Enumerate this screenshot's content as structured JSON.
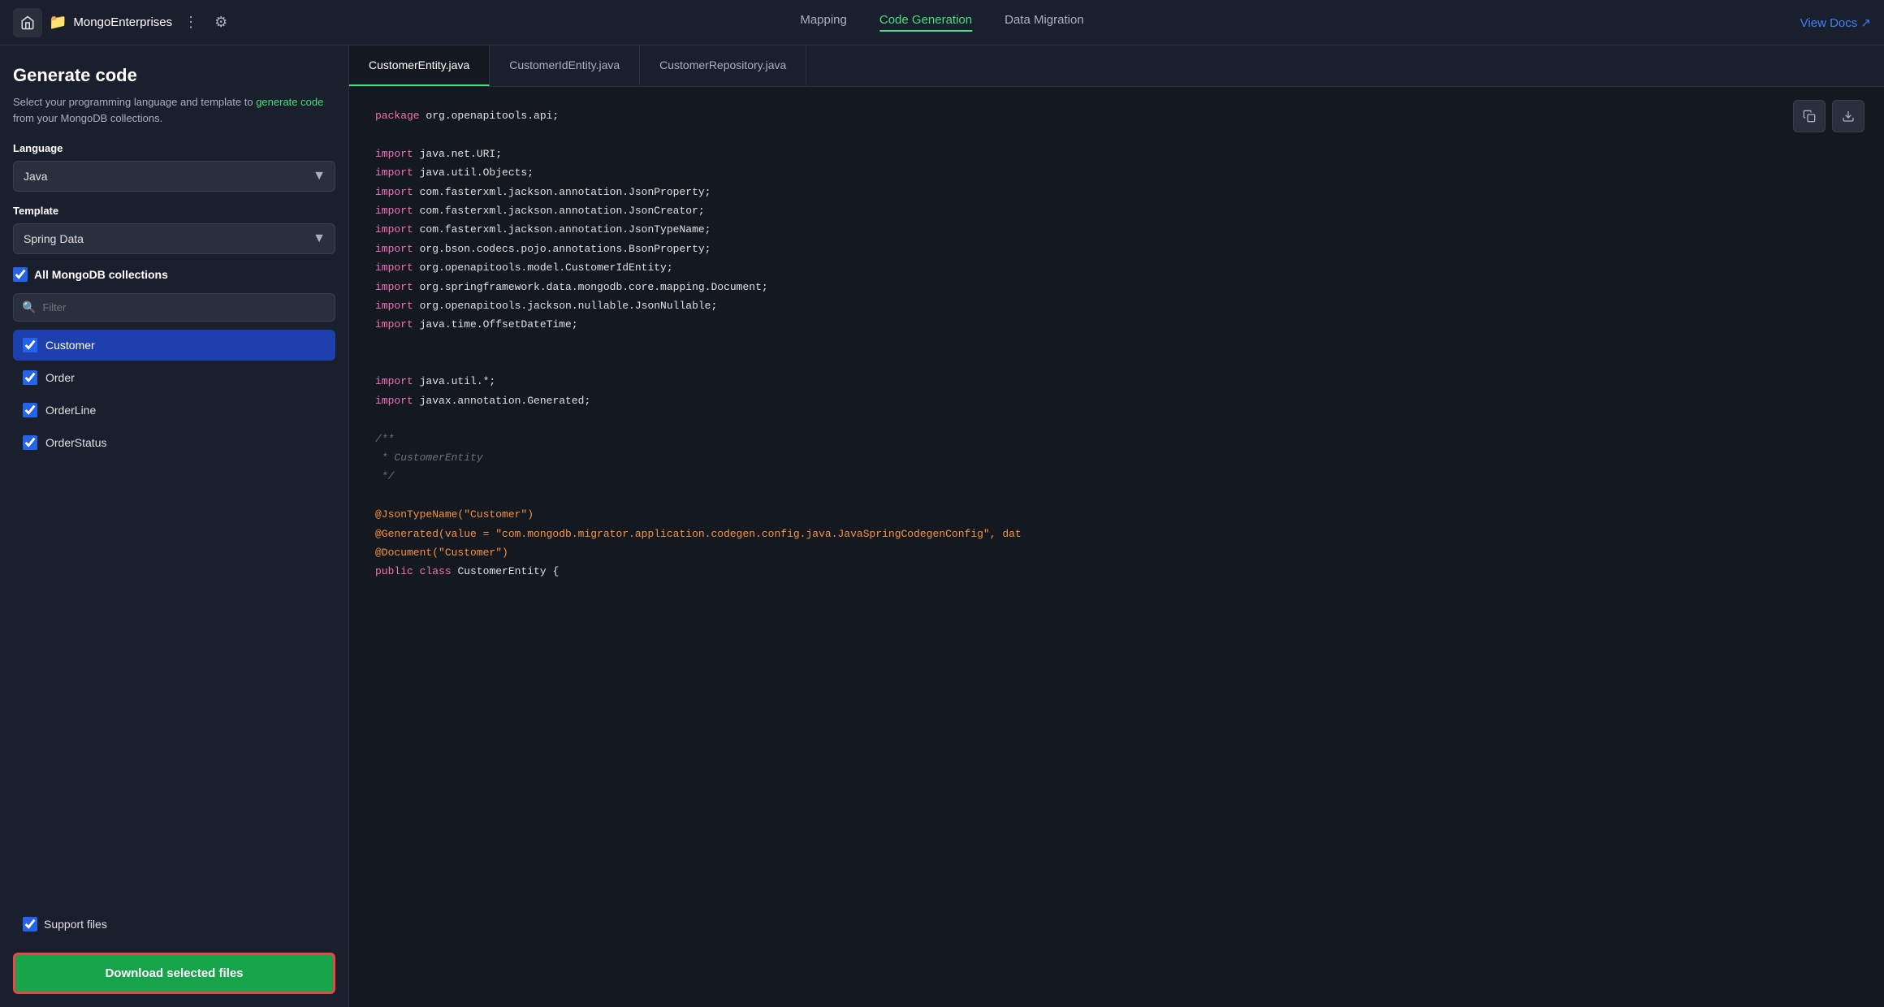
{
  "topNav": {
    "projectName": "MongoEnterprises",
    "tabs": [
      {
        "id": "mapping",
        "label": "Mapping",
        "active": false
      },
      {
        "id": "code-generation",
        "label": "Code Generation",
        "active": true
      },
      {
        "id": "data-migration",
        "label": "Data Migration",
        "active": false
      }
    ],
    "viewDocsLabel": "View Docs ↗"
  },
  "sidebar": {
    "title": "Generate code",
    "description": "Select your programming language and template to",
    "descriptionLink": "generate code",
    "descriptionSuffix": " from your MongoDB collections.",
    "languageLabel": "Language",
    "languageValue": "Java",
    "templateLabel": "Template",
    "templateValue": "Spring Data",
    "allCollectionsLabel": "All MongoDB collections",
    "searchPlaceholder": "Filter",
    "collections": [
      {
        "name": "Customer",
        "checked": true,
        "active": true
      },
      {
        "name": "Order",
        "checked": true,
        "active": false
      },
      {
        "name": "OrderLine",
        "checked": true,
        "active": false
      },
      {
        "name": "OrderStatus",
        "checked": true,
        "active": false
      }
    ],
    "supportFilesLabel": "Support files",
    "supportFilesChecked": true,
    "downloadLabel": "Download selected files"
  },
  "codeTabs": [
    {
      "label": "CustomerEntity.java",
      "active": true
    },
    {
      "label": "CustomerIdEntity.java",
      "active": false
    },
    {
      "label": "CustomerRepository.java",
      "active": false
    }
  ],
  "codeContent": {
    "lines": [
      {
        "type": "package",
        "text": "package org.openapitools.api;"
      },
      {
        "type": "blank"
      },
      {
        "type": "import",
        "text": "import java.net.URI;"
      },
      {
        "type": "import",
        "text": "import java.util.Objects;"
      },
      {
        "type": "import",
        "text": "import com.fasterxml.jackson.annotation.JsonProperty;"
      },
      {
        "type": "import",
        "text": "import com.fasterxml.jackson.annotation.JsonCreator;"
      },
      {
        "type": "import",
        "text": "import com.fasterxml.jackson.annotation.JsonTypeName;"
      },
      {
        "type": "import",
        "text": "import org.bson.codecs.pojo.annotations.BsonProperty;"
      },
      {
        "type": "import",
        "text": "import org.openapitools.model.CustomerIdEntity;"
      },
      {
        "type": "import",
        "text": "import org.springframework.data.mongodb.core.mapping.Document;"
      },
      {
        "type": "import",
        "text": "import org.openapitools.jackson.nullable.JsonNullable;"
      },
      {
        "type": "import",
        "text": "import java.time.OffsetDateTime;"
      },
      {
        "type": "blank"
      },
      {
        "type": "blank"
      },
      {
        "type": "import",
        "text": "import java.util.*;"
      },
      {
        "type": "import",
        "text": "import javax.annotation.Generated;"
      },
      {
        "type": "blank"
      },
      {
        "type": "comment",
        "text": "/**"
      },
      {
        "type": "comment",
        "text": " * CustomerEntity"
      },
      {
        "type": "comment",
        "text": " */"
      },
      {
        "type": "blank"
      },
      {
        "type": "annotation",
        "text": "@JsonTypeName(\"Customer\")"
      },
      {
        "type": "annotation",
        "text": "@Generated(value = \"com.mongodb.migrator.application.codegen.config.java.JavaSpringCodegenConfig\", dat"
      },
      {
        "type": "annotation",
        "text": "@Document(\"Customer\")"
      },
      {
        "type": "class",
        "text": "public class CustomerEntity {"
      }
    ]
  }
}
